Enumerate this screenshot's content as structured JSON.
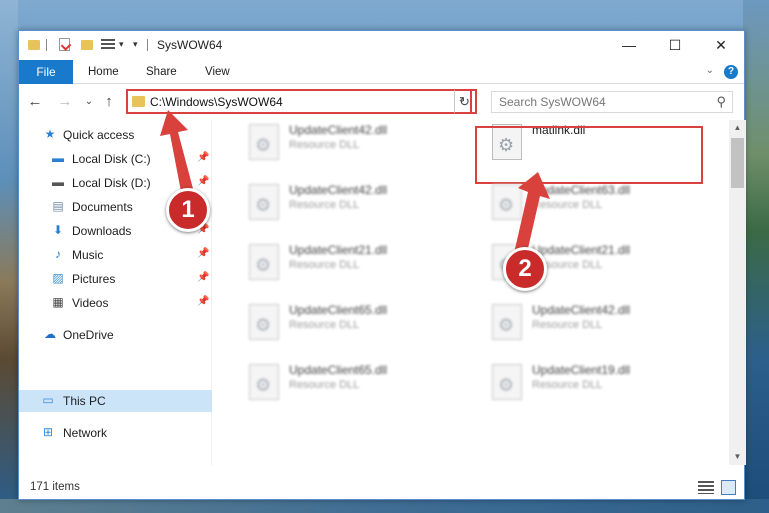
{
  "window": {
    "title": "SysWOW64",
    "controls": {
      "minimize": "—",
      "maximize": "☐",
      "close": "✕"
    }
  },
  "ribbon": {
    "tabs": [
      "File",
      "Home",
      "Share",
      "View"
    ],
    "collapse_caret": "⌄",
    "help": "?"
  },
  "address": {
    "path": "C:\\Windows\\SysWOW64",
    "dropdown": "⌄",
    "refresh": "↻"
  },
  "navigation_buttons": {
    "back": "←",
    "forward": "→",
    "recent": "⌄",
    "up": "↑"
  },
  "search": {
    "placeholder": "Search SysWOW64",
    "icon": "search-icon"
  },
  "sidebar": {
    "items": [
      {
        "label": "Quick access",
        "icon": "star-icon",
        "pinned": false
      },
      {
        "label": "Local Disk (C:)",
        "icon": "drive-windows-icon",
        "pinned": true
      },
      {
        "label": "Local Disk (D:)",
        "icon": "drive-icon",
        "pinned": true
      },
      {
        "label": "Documents",
        "icon": "documents-icon",
        "pinned": true
      },
      {
        "label": "Downloads",
        "icon": "download-icon",
        "pinned": true
      },
      {
        "label": "Music",
        "icon": "music-icon",
        "pinned": true
      },
      {
        "label": "Pictures",
        "icon": "pictures-icon",
        "pinned": true
      },
      {
        "label": "Videos",
        "icon": "videos-icon",
        "pinned": true
      },
      {
        "label": "OneDrive",
        "icon": "cloud-icon",
        "pinned": false
      },
      {
        "label": "This PC",
        "icon": "computer-icon",
        "pinned": false,
        "selected": true
      },
      {
        "label": "Network",
        "icon": "network-icon",
        "pinned": false
      }
    ]
  },
  "files": [
    {
      "name": "UpdateClient42.dll",
      "type": "Resource DLL",
      "blurred": true
    },
    {
      "name": "matlink.dll",
      "type": "",
      "blurred": false,
      "highlighted": true
    },
    {
      "name": "UpdateClient42.dll",
      "type": "Resource DLL",
      "blurred": true
    },
    {
      "name": "UpdateClient63.dll",
      "type": "Resource DLL",
      "blurred": true
    },
    {
      "name": "UpdateClient21.dll",
      "type": "Resource DLL",
      "blurred": true
    },
    {
      "name": "UpdateClient21.dll",
      "type": "Resource DLL",
      "blurred": true
    },
    {
      "name": "UpdateClient65.dll",
      "type": "Resource DLL",
      "blurred": true
    },
    {
      "name": "UpdateClient42.dll",
      "type": "Resource DLL",
      "blurred": true
    },
    {
      "name": "UpdateClient65.dll",
      "type": "Resource DLL",
      "blurred": true
    },
    {
      "name": "UpdateClient19.dll",
      "type": "Resource DLL",
      "blurred": true
    }
  ],
  "status": {
    "item_count": "171 items"
  },
  "annotations": {
    "step1": "1",
    "step2": "2",
    "color": "#d9413c"
  }
}
